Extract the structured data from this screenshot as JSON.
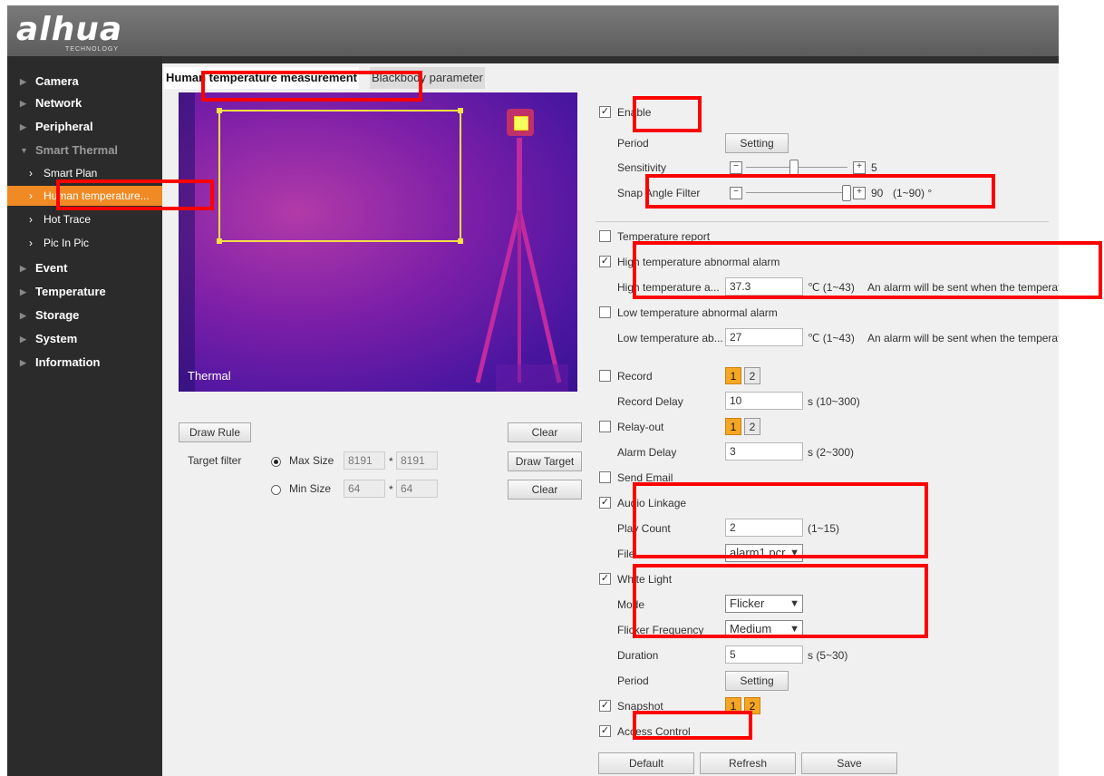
{
  "brand": {
    "logo": "alhua",
    "tagline": "TECHNOLOGY"
  },
  "sidebar": {
    "items": [
      {
        "label": "Camera"
      },
      {
        "label": "Network"
      },
      {
        "label": "Peripheral"
      },
      {
        "label": "Smart Thermal"
      },
      {
        "label": "Smart Plan"
      },
      {
        "label": "Human temperature..."
      },
      {
        "label": "Hot Trace"
      },
      {
        "label": "Pic In Pic"
      },
      {
        "label": "Event"
      },
      {
        "label": "Temperature"
      },
      {
        "label": "Storage"
      },
      {
        "label": "System"
      },
      {
        "label": "Information"
      }
    ]
  },
  "tabs": [
    {
      "label": "Human temperature measurement"
    },
    {
      "label": "Blackbody parameter"
    }
  ],
  "preview": {
    "channel_label": "Thermal"
  },
  "left_controls": {
    "draw_rule": "Draw Rule",
    "clear1": "Clear",
    "target_filter": "Target filter",
    "max_size": "Max Size",
    "max_w": "8191",
    "max_h": "8191",
    "draw_target": "Draw Target",
    "min_size": "Min Size",
    "min_w": "64",
    "min_h": "64",
    "clear2": "Clear",
    "times": "*"
  },
  "settings": {
    "enable": "Enable",
    "period": "Period",
    "setting_btn": "Setting",
    "sensitivity": "Sensitivity",
    "sensitivity_value": "5",
    "snap_angle_filter": "Snap Angle Filter",
    "snap_angle_value": "90",
    "snap_angle_range": "(1~90) °",
    "temperature_report": "Temperature report",
    "high_alarm": "High temperature abnormal alarm",
    "high_threshold_label": "High temperature a...",
    "high_threshold": "37.3",
    "high_unit": "℃ (1~43)",
    "high_note": "An alarm will be sent when the temperat",
    "low_alarm": "Low temperature abnormal alarm",
    "low_threshold_label": "Low temperature ab...",
    "low_threshold": "27",
    "low_unit": "℃ (1~43)",
    "low_note": "An alarm will be sent when the temperat",
    "record": "Record",
    "record_delay": "Record Delay",
    "record_delay_value": "10",
    "record_delay_range": "s (10~300)",
    "relay_out": "Relay-out",
    "alarm_delay": "Alarm Delay",
    "alarm_delay_value": "3",
    "alarm_delay_range": "s (2~300)",
    "send_email": "Send Email",
    "audio_linkage": "Audio Linkage",
    "play_count": "Play Count",
    "play_count_value": "2",
    "play_count_range": "(1~15)",
    "file": "File",
    "file_value": "alarm1.pcr",
    "white_light": "White Light",
    "mode": "Mode",
    "mode_value": "Flicker",
    "flicker_frequency": "Flicker Frequency",
    "flicker_value": "Medium",
    "duration": "Duration",
    "duration_value": "5",
    "duration_range": "s (5~30)",
    "period2": "Period",
    "setting_btn2": "Setting",
    "snapshot": "Snapshot",
    "access_control": "Access Control",
    "num1": "1",
    "num2": "2",
    "check": "✓"
  },
  "footer": {
    "default": "Default",
    "refresh": "Refresh",
    "save": "Save"
  }
}
